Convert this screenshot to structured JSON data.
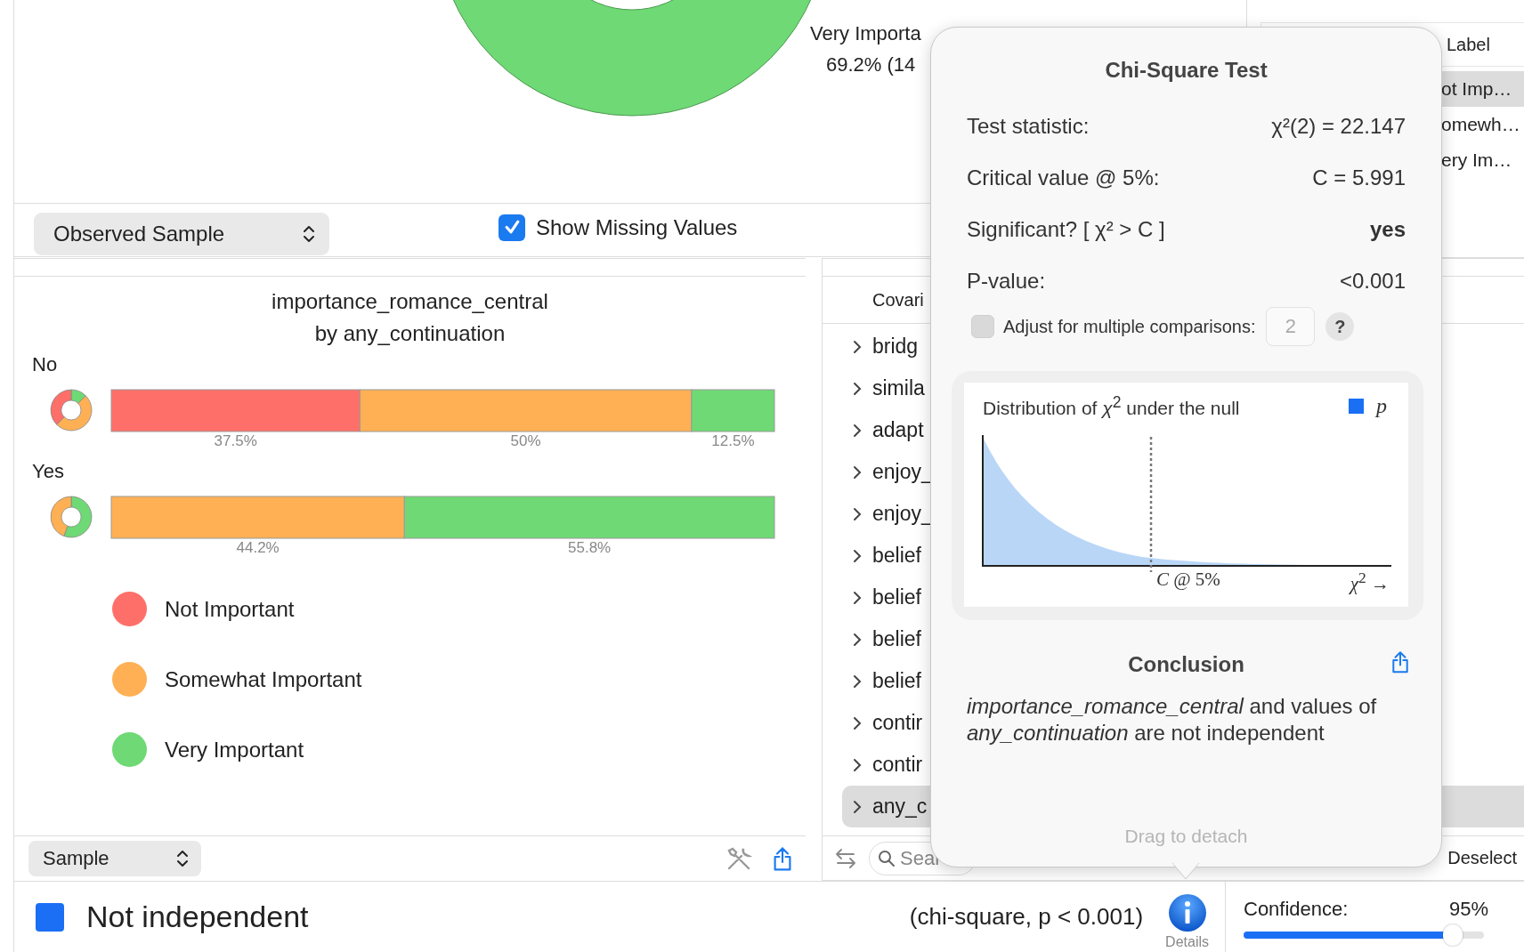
{
  "top_chart": {
    "slice_label": "Very Importa",
    "slice_value": "69.2% (14"
  },
  "top_toolbar": {
    "view_popup": "Observed Sample",
    "show_missing": {
      "label": "Show Missing Values",
      "checked": true
    }
  },
  "label_table": {
    "column": "Label",
    "rows": [
      {
        "text": "ot Imp…",
        "selected": true
      },
      {
        "text": "omewh…",
        "selected": false
      },
      {
        "text": "ery Im…",
        "selected": false
      }
    ]
  },
  "chart_panel": {
    "title_lines": [
      "importance_romance_central",
      "by any_continuation"
    ],
    "chart_data": {
      "type": "bar",
      "orientation": "horizontal",
      "stacked": true,
      "categories": [
        "No",
        "Yes"
      ],
      "series": [
        {
          "name": "Not Important",
          "color": "#ff6f69",
          "values": [
            37.5,
            null
          ],
          "value_labels": [
            "37.5%",
            null
          ]
        },
        {
          "name": "Somewhat Important",
          "color": "#ffb054",
          "values": [
            50,
            44.2
          ],
          "value_labels": [
            "50%",
            "44.2%"
          ]
        },
        {
          "name": "Very Important",
          "color": "#6fd975",
          "values": [
            12.5,
            55.8
          ],
          "value_labels": [
            "12.5%",
            "55.8%"
          ]
        }
      ],
      "legend": "bottom"
    },
    "popup": "Sample"
  },
  "covariates": {
    "header": "Covari",
    "items": [
      {
        "name": "bridg",
        "selected": false
      },
      {
        "name": "simila",
        "selected": false
      },
      {
        "name": "adapt",
        "selected": false
      },
      {
        "name": "enjoy_",
        "selected": false
      },
      {
        "name": "enjoy_",
        "selected": false
      },
      {
        "name": "belief",
        "selected": false
      },
      {
        "name": "belief",
        "selected": false
      },
      {
        "name": "belief",
        "selected": false
      },
      {
        "name": "belief",
        "selected": false
      },
      {
        "name": "contir",
        "selected": false
      },
      {
        "name": "contir",
        "selected": false
      },
      {
        "name": "any_c",
        "selected": true
      }
    ],
    "search": {
      "placeholder": "Sear"
    },
    "deselect": "Deselect"
  },
  "status_bar": {
    "result": "Not independent",
    "detail": "(chi-square, p < 0.001)",
    "details_button": "Details",
    "confidence": {
      "label": "Confidence:",
      "value": "95%",
      "level": 0.87
    }
  },
  "popover": {
    "title": "Chi-Square Test",
    "stats": [
      {
        "label": "Test statistic:",
        "value": "χ²(2) = 22.147",
        "emphasis": false
      },
      {
        "label": "Critical value @ 5%:",
        "value": "C = 5.991",
        "emphasis": false
      },
      {
        "label": "Significant? [ χ² > C ]",
        "value": "yes",
        "emphasis": true
      },
      {
        "label": "P-value:",
        "value": "<0.001",
        "emphasis": false
      }
    ],
    "adjust": {
      "label": "Adjust for multiple comparisons:",
      "checked": false,
      "value": "2",
      "disabled": true
    },
    "help_button": "?",
    "distribution": {
      "title": "Distribution of *χ*$^{2}$ under the null",
      "legend": "p",
      "critical_label": "*C* @ 5%",
      "axis_label": "*χ*$^{2}$ →"
    },
    "conclusion": {
      "title": "Conclusion",
      "text": "*importance_romance_central* and values of *any_continuation* are not independent"
    },
    "footer": "Drag to detach"
  }
}
